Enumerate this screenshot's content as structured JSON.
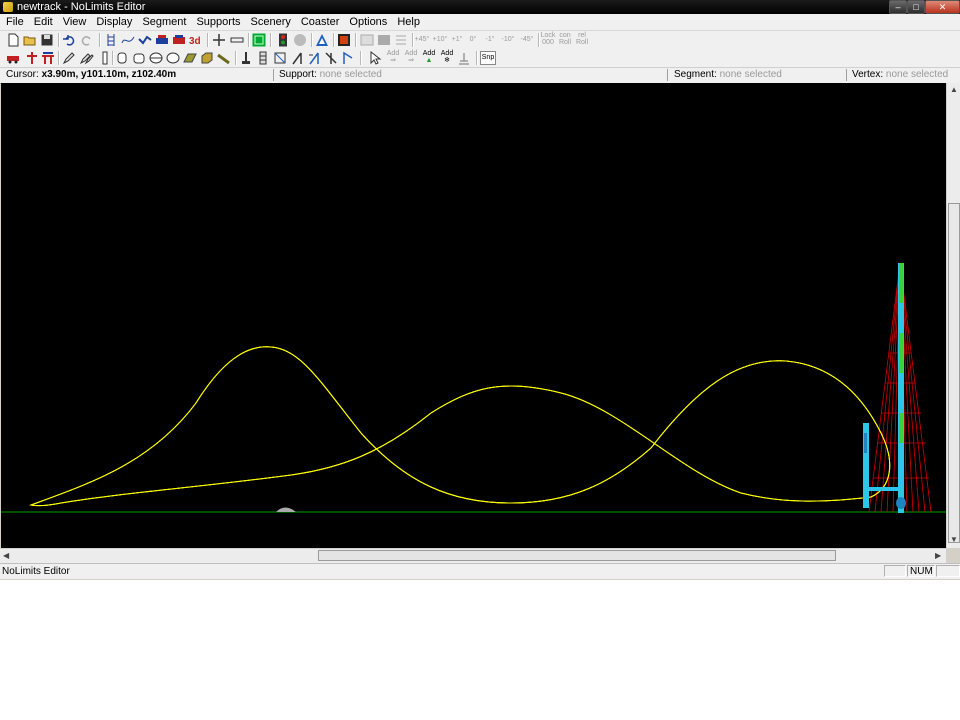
{
  "window": {
    "title": "newtrack - NoLimits Editor"
  },
  "menu": [
    "File",
    "Edit",
    "View",
    "Display",
    "Segment",
    "Supports",
    "Scenery",
    "Coaster",
    "Options",
    "Help"
  ],
  "toolbar": {
    "text_buttons": {
      "nudge": [
        "+45°",
        "+10°",
        "+1°",
        "0°",
        "-1°",
        "-10°",
        "-45°"
      ],
      "lock_roll": [
        "Lock",
        "000"
      ],
      "con_roll": [
        "con",
        "Roll"
      ],
      "rel_roll": [
        "rel",
        "Roll"
      ],
      "add_labels": [
        "Add",
        "Add",
        "Add",
        "Add"
      ],
      "snap": "Snp"
    }
  },
  "infobar": {
    "cursor_label": "Cursor:",
    "cursor_value": "x3.90m, y101.10m, z102.40m",
    "support_label": "Support:",
    "support_value": "none selected",
    "segment_label": "Segment:",
    "segment_value": "none selected",
    "vertex_label": "Vertex:",
    "vertex_value": "none selected"
  },
  "statusbar": {
    "left": "NoLimits Editor",
    "num": "NUM"
  },
  "colors": {
    "track_outline": "#ffff00",
    "track_rails": "#2dc6e8",
    "ground": "#00a000",
    "supports": "#e00000",
    "lift_tower": "#3bd13b"
  }
}
